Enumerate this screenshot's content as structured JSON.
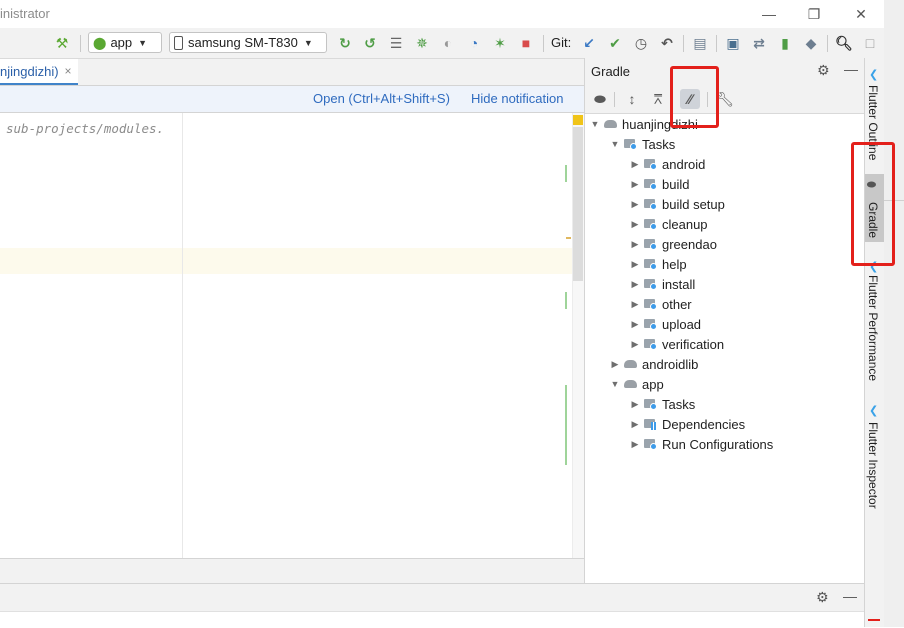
{
  "window": {
    "title_fragment": "inistrator",
    "buttons": [
      "minimize",
      "restore",
      "close"
    ]
  },
  "toolbar": {
    "run_config": "app",
    "device": "samsung SM-T830",
    "git_label": "Git:"
  },
  "editor": {
    "tab_title": "njingdizhi)",
    "tab_close": "×",
    "notification": {
      "open_label": "Open (Ctrl+Alt+Shift+S)",
      "hide_label": "Hide notification"
    },
    "code_line": "sub-projects/modules."
  },
  "gradle": {
    "title": "Gradle",
    "tree": [
      {
        "label": "huanjingdizhi",
        "level": 0,
        "expanded": true,
        "icon": "gradle-elephant-icon"
      },
      {
        "label": "Tasks",
        "level": 1,
        "expanded": true,
        "icon": "task-folder-icon"
      },
      {
        "label": "android",
        "level": 2,
        "expanded": false,
        "icon": "task-folder-icon"
      },
      {
        "label": "build",
        "level": 2,
        "expanded": false,
        "icon": "task-folder-icon"
      },
      {
        "label": "build setup",
        "level": 2,
        "expanded": false,
        "icon": "task-folder-icon"
      },
      {
        "label": "cleanup",
        "level": 2,
        "expanded": false,
        "icon": "task-folder-icon"
      },
      {
        "label": "greendao",
        "level": 2,
        "expanded": false,
        "icon": "task-folder-icon"
      },
      {
        "label": "help",
        "level": 2,
        "expanded": false,
        "icon": "task-folder-icon"
      },
      {
        "label": "install",
        "level": 2,
        "expanded": false,
        "icon": "task-folder-icon"
      },
      {
        "label": "other",
        "level": 2,
        "expanded": false,
        "icon": "task-folder-icon"
      },
      {
        "label": "upload",
        "level": 2,
        "expanded": false,
        "icon": "task-folder-icon"
      },
      {
        "label": "verification",
        "level": 2,
        "expanded": false,
        "icon": "task-folder-icon"
      },
      {
        "label": "androidlib",
        "level": 1,
        "expanded": false,
        "icon": "gradle-elephant-icon"
      },
      {
        "label": "app",
        "level": 1,
        "expanded": true,
        "icon": "gradle-elephant-icon"
      },
      {
        "label": "Tasks",
        "level": 2,
        "expanded": false,
        "icon": "task-folder-icon"
      },
      {
        "label": "Dependencies",
        "level": 2,
        "expanded": false,
        "icon": "dependencies-icon"
      },
      {
        "label": "Run Configurations",
        "level": 2,
        "expanded": false,
        "icon": "task-folder-icon"
      }
    ]
  },
  "right_strip": {
    "tabs": [
      "Flutter Outline",
      "Gradle",
      "Flutter Performance",
      "Flutter Inspector"
    ]
  },
  "colors": {
    "accent": "#2f6bbf",
    "annotation": "#e3201b",
    "android_green": "#5aa832"
  }
}
